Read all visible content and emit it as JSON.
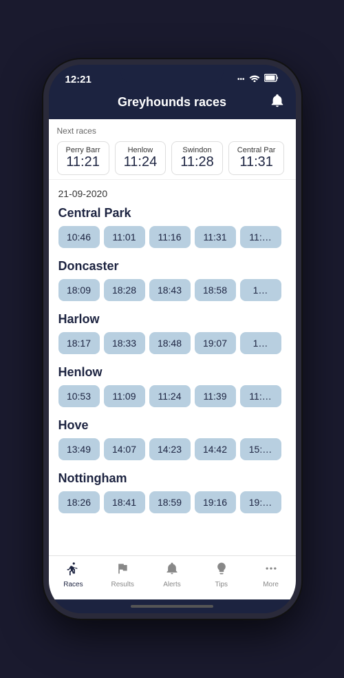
{
  "statusBar": {
    "time": "12:21"
  },
  "header": {
    "title": "Greyhounds races"
  },
  "nextRaces": {
    "label": "Next races",
    "items": [
      {
        "venue": "Perry Barr",
        "time": "11:21"
      },
      {
        "venue": "Henlow",
        "time": "11:24"
      },
      {
        "venue": "Swindon",
        "time": "11:28"
      },
      {
        "venue": "Central Par",
        "time": "11:31"
      }
    ]
  },
  "dateHeader": "21-09-2020",
  "venues": [
    {
      "name": "Central Park",
      "times": [
        "10:46",
        "11:01",
        "11:16",
        "11:31",
        "11:…"
      ]
    },
    {
      "name": "Doncaster",
      "times": [
        "18:09",
        "18:28",
        "18:43",
        "18:58",
        "1…"
      ]
    },
    {
      "name": "Harlow",
      "times": [
        "18:17",
        "18:33",
        "18:48",
        "19:07",
        "1…"
      ]
    },
    {
      "name": "Henlow",
      "times": [
        "10:53",
        "11:09",
        "11:24",
        "11:39",
        "11:…"
      ]
    },
    {
      "name": "Hove",
      "times": [
        "13:49",
        "14:07",
        "14:23",
        "14:42",
        "15:…"
      ]
    },
    {
      "name": "Nottingham",
      "times": [
        "18:26",
        "18:41",
        "18:59",
        "19:16",
        "19:…"
      ]
    }
  ],
  "bottomNav": {
    "items": [
      {
        "icon": "races",
        "label": "Races",
        "active": true
      },
      {
        "icon": "results",
        "label": "Results",
        "active": false
      },
      {
        "icon": "alerts",
        "label": "Alerts",
        "active": false
      },
      {
        "icon": "tips",
        "label": "Tips",
        "active": false
      },
      {
        "icon": "more",
        "label": "More",
        "active": false
      }
    ]
  }
}
